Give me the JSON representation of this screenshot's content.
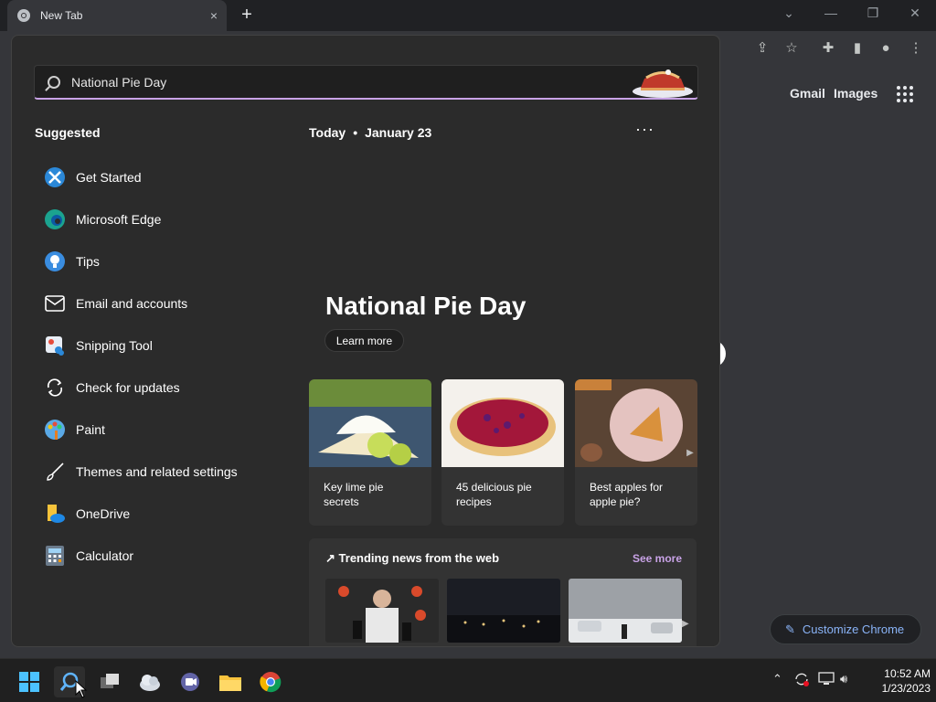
{
  "browser": {
    "tab_title": "New Tab",
    "close_glyph": "×",
    "new_tab_glyph": "+",
    "links": {
      "gmail": "Gmail",
      "images": "Images"
    },
    "customize_label": "Customize Chrome"
  },
  "search": {
    "query": "National Pie Day"
  },
  "suggested": {
    "title": "Suggested",
    "items": [
      {
        "label": "Get Started",
        "icon": "get-started-icon"
      },
      {
        "label": "Microsoft Edge",
        "icon": "edge-icon"
      },
      {
        "label": "Tips",
        "icon": "tips-bulb-icon"
      },
      {
        "label": "Email and accounts",
        "icon": "mail-icon"
      },
      {
        "label": "Snipping Tool",
        "icon": "snipping-tool-icon"
      },
      {
        "label": "Check for updates",
        "icon": "refresh-icon"
      },
      {
        "label": "Paint",
        "icon": "paint-palette-icon"
      },
      {
        "label": "Themes and related settings",
        "icon": "brush-icon"
      },
      {
        "label": "OneDrive",
        "icon": "onedrive-icon"
      },
      {
        "label": "Calculator",
        "icon": "calculator-icon"
      }
    ]
  },
  "today": {
    "label": "Today",
    "separator": "•",
    "date": "January 23",
    "more_glyph": "···",
    "hero_title": "National Pie Day",
    "learn_more": "Learn more",
    "cards": [
      {
        "line1": "Key lime pie",
        "line2": "secrets"
      },
      {
        "line1": "45 delicious pie",
        "line2": "recipes"
      },
      {
        "line1": "Best apples for",
        "line2": "apple pie?"
      }
    ],
    "trending_title": "Trending news from the web",
    "see_more": "See more"
  },
  "taskbar": {
    "time": "10:52 AM",
    "date": "1/23/2023"
  },
  "colors": {
    "accent": "#c8a2e6",
    "chrome_link": "#8ab4f8"
  }
}
